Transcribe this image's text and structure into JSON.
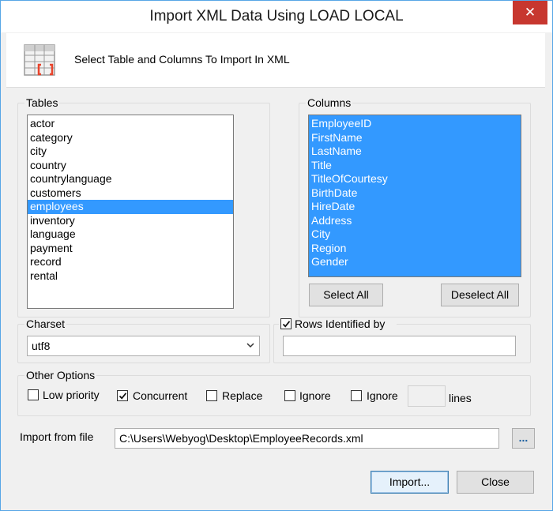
{
  "window": {
    "title": "Import XML Data Using LOAD LOCAL",
    "close_glyph": "✕"
  },
  "header": {
    "icon": "table-columns-icon",
    "text": "Select Table and Columns To Import In XML"
  },
  "tables": {
    "label": "Tables",
    "items": [
      "actor",
      "category",
      "city",
      "country",
      "countrylanguage",
      "customers",
      "employees",
      "inventory",
      "language",
      "payment",
      "record",
      "rental"
    ],
    "selected_index": 6
  },
  "columns": {
    "label": "Columns",
    "items": [
      "EmployeeID",
      "FirstName",
      "LastName",
      "Title",
      "TitleOfCourtesy",
      "BirthDate",
      "HireDate",
      "Address",
      "City",
      "Region",
      "Gender"
    ],
    "select_all_label": "Select All",
    "deselect_all_label": "Deselect All"
  },
  "charset": {
    "label": "Charset",
    "value": "utf8"
  },
  "rows_identified": {
    "label": "Rows Identified by",
    "checked": true,
    "value": ""
  },
  "other_options": {
    "label": "Other Options",
    "low_priority": {
      "label": "Low priority",
      "checked": false
    },
    "concurrent": {
      "label": "Concurrent",
      "checked": true
    },
    "replace": {
      "label": "Replace",
      "checked": false
    },
    "ignore": {
      "label": "Ignore",
      "checked": false
    },
    "ignore_lines": {
      "label": "Ignore",
      "checked": false,
      "value": "",
      "suffix": "lines"
    }
  },
  "import_file": {
    "label": "Import from file",
    "path": "C:\\Users\\Webyog\\Desktop\\EmployeeRecords.xml",
    "browse_label": "..."
  },
  "footer": {
    "import_label": "Import...",
    "close_label": "Close"
  },
  "colors": {
    "selection": "#3399ff",
    "close_button": "#c7372f",
    "window_border": "#57a6e6"
  }
}
